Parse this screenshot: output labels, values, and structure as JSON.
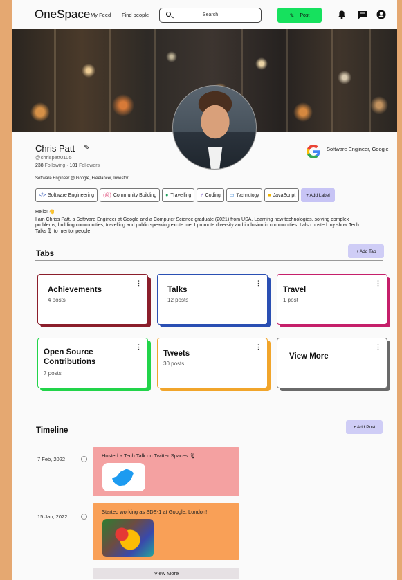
{
  "header": {
    "logo": "OneSpace",
    "nav": [
      "My Feed",
      "Find people"
    ],
    "search_placeholder": "Search",
    "post_label": "Post",
    "icons": [
      "bell-icon",
      "message-icon",
      "account-icon"
    ]
  },
  "profile": {
    "name": "Chris Patt",
    "handle": "@chrispatt0105",
    "following_count": "238",
    "following_label": "Following",
    "followers_count": "101",
    "followers_label": "Followers",
    "headline": "Software Engineer @ Google, Freelancer, Investor",
    "job": "Software Engineer, Google",
    "labels": [
      {
        "text": "Software Engineering",
        "icon": "</>"
      },
      {
        "text": "Community Building",
        "icon": "(@)"
      },
      {
        "text": "Travelling",
        "icon": "●"
      },
      {
        "text": "Coding",
        "icon": "⑂"
      },
      {
        "text": "Technology",
        "icon": "▭"
      },
      {
        "text": "JavaScript",
        "icon": "■"
      }
    ],
    "add_label": "+ Add Label",
    "bio_greeting": "Hello! 👋",
    "bio": "I am Chriss Patt, a Software Engineer at Google and a Computer Science graduate (2021) from USA. Learning new technologies, solving complex problems, building communities, travelling and public speaking excite me. I promote diversity and inclusion in communities. I also hosted my show Tech Talks🎙 to mentor people."
  },
  "tabs": {
    "title": "Tabs",
    "add_label": "+ Add Tab",
    "cards": [
      {
        "title": "Achievements",
        "count": "4 posts",
        "color": "#8b1e2b"
      },
      {
        "title": "Talks",
        "count": "12 posts",
        "color": "#2a4fb3"
      },
      {
        "title": "Travel",
        "count": "1 post",
        "color": "#c51f6a"
      },
      {
        "title": "Open Source Contributions",
        "count": "7 posts",
        "color": "#22d44a"
      },
      {
        "title": "Tweets",
        "count": "30 posts",
        "color": "#f1a52b"
      },
      {
        "title": "View More",
        "count": "",
        "color": "#6a6a6a"
      }
    ]
  },
  "timeline": {
    "title": "Timeline",
    "add_label": "+ Add Post",
    "events": [
      {
        "date": "7 Feb, 2022",
        "text": "Hosted a Tech Talk on Twitter Spaces 🎙",
        "color": "#f4a1a1"
      },
      {
        "date": "15 Jan, 2022",
        "text": "Started working as SDE-1 at Google, London!",
        "color": "#f9a057"
      }
    ],
    "view_more": "View More"
  }
}
